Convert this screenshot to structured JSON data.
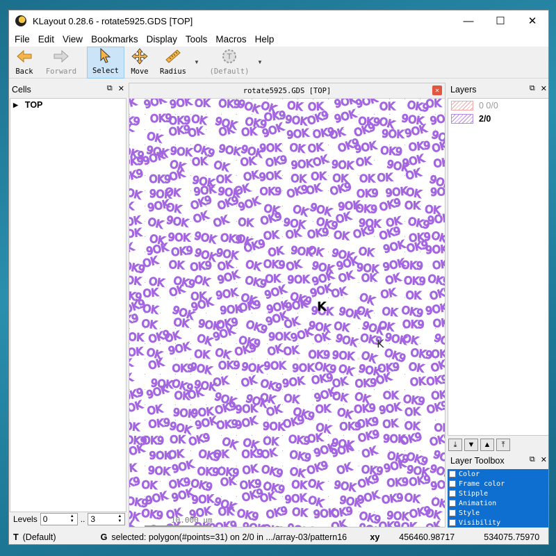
{
  "window": {
    "title": "KLayout 0.28.6 - rotate5925.GDS [TOP]",
    "minimize_glyph": "—",
    "maximize_glyph": "☐",
    "close_glyph": "✕"
  },
  "menu": [
    "File",
    "Edit",
    "View",
    "Bookmarks",
    "Display",
    "Tools",
    "Macros",
    "Help"
  ],
  "toolbar": {
    "back": "Back",
    "forward": "Forward",
    "select": "Select",
    "move": "Move",
    "radius": "Radius",
    "default": "(Default)"
  },
  "cells": {
    "title": "Cells",
    "root": "TOP",
    "levels_label": "Levels",
    "level_min": "0",
    "level_sep": "..",
    "level_max": "3"
  },
  "canvas": {
    "tab_title": "rotate5925.GDS [TOP]",
    "scale_label": "10.000 µm",
    "pattern_texts": [
      "OK",
      "OK9",
      "9OK"
    ],
    "highlight_text": "K"
  },
  "layers": {
    "title": "Layers",
    "items": [
      {
        "label": "0 0/0",
        "color": "#f2a8a8",
        "dim": true
      },
      {
        "label": "2/0",
        "color": "#b58ae6",
        "dim": false
      }
    ]
  },
  "toolbox": {
    "title": "Layer Toolbox",
    "items": [
      "Color",
      "Frame color",
      "Stipple",
      "Animation",
      "Style",
      "Visibility"
    ]
  },
  "status": {
    "mode_key": "T",
    "mode_value": "(Default)",
    "grid_key": "G",
    "message": "selected: polygon(#points=31) on 2/0 in .../array-03/pattern16",
    "coord_key": "xy",
    "x": "456460.98717",
    "y": "534075.75970"
  },
  "colors": {
    "shape": "#a466e0",
    "accent": "#0e6fd1"
  }
}
